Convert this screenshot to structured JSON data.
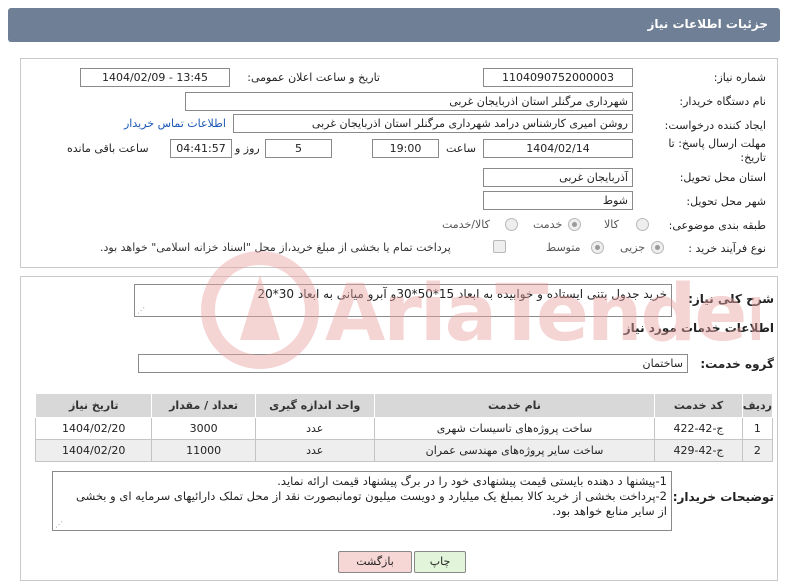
{
  "header": {
    "title": "جزئیات اطلاعات نیاز"
  },
  "form": {
    "need_number_label": "شماره نیاز:",
    "need_number": "1104090752000003",
    "announce_label": "تاریخ و ساعت اعلان عمومی:",
    "announce_value": "1404/02/09 - 13:45",
    "buyer_org_label": "نام دستگاه خریدار:",
    "buyer_org": "شهرداری مرگنلر استان اذربایجان غربی",
    "requester_label": "ایجاد کننده درخواست:",
    "requester": "روشن امیری کارشناس درامد شهرداری مرگنلر استان اذربایجان غربی",
    "contact_link": "اطلاعات تماس خریدار",
    "deadline_label_1": "مهلت ارسال پاسخ: تا",
    "deadline_label_2": "تاریخ:",
    "deadline_date": "1404/02/14",
    "time_label": "ساعت",
    "deadline_time": "19:00",
    "days_value": "5",
    "days_label": "روز و",
    "remaining_time": "04:41:57",
    "remaining_label": "ساعت باقی مانده",
    "province_label": "استان محل تحویل:",
    "province": "آذربایجان غربی",
    "city_label": "شهر محل تحویل:",
    "city": "شوط",
    "category_label": "طبقه بندی موضوعی:",
    "category_options": [
      "کالا",
      "خدمت",
      "کالا/خدمت"
    ],
    "category_selected": "خدمت",
    "process_label": "نوع فرآیند خرید :",
    "process_options": [
      "جزیی",
      "متوسط"
    ],
    "process_selected": "جزیی",
    "payment_note": "پرداخت تمام یا بخشی از مبلغ خرید،از محل \"اسناد خزانه اسلامی\" خواهد بود."
  },
  "description": {
    "label": "شرح کلی نیاز:",
    "text": "خرید جدول بتنی ایستاده و خوابیده به ابعاد 15*50*30و آبرو میانی به ابعاد 30*20"
  },
  "services": {
    "section_title": "اطلاعات خدمات مورد نیاز",
    "group_label": "گروه خدمت:",
    "group_value": "ساختمان",
    "columns": [
      "ردیف",
      "کد خدمت",
      "نام خدمت",
      "واحد اندازه گیری",
      "تعداد / مقدار",
      "تاریخ نیاز"
    ],
    "rows": [
      [
        "1",
        "ج-42-422",
        "ساخت پروژه‌های تاسیسات شهری",
        "عدد",
        "3000",
        "1404/02/20"
      ],
      [
        "2",
        "ج-42-429",
        "ساخت سایر پروژه‌های مهندسی عمران",
        "عدد",
        "11000",
        "1404/02/20"
      ]
    ]
  },
  "buyer_notes": {
    "label": "توضیحات خریدار:",
    "line1": "1-پیشنها د دهنده بایستی  قیمت پیشنهادی خود را در برگ پیشنهاد قیمت ارائه نماید.",
    "line2": "2-پرداخت بخشی از خرید کالا بمبلغ یک میلیارد و دویست میلیون تومانبصورت نقد از محل تملک دارائیهای سرمایه ای و بخشی",
    "line3": "از سایر منابع خواهد بود."
  },
  "buttons": {
    "print": "چاپ",
    "back": "بازگشت"
  },
  "watermark": {
    "text": "AriaTender.neT"
  },
  "colors": {
    "header_bg": "#6f7f95",
    "link": "#1a57b5",
    "back_button_bg": "#f7d6d6",
    "print_button_bg": "#e2f5da",
    "watermark": "#e9a2a2"
  }
}
